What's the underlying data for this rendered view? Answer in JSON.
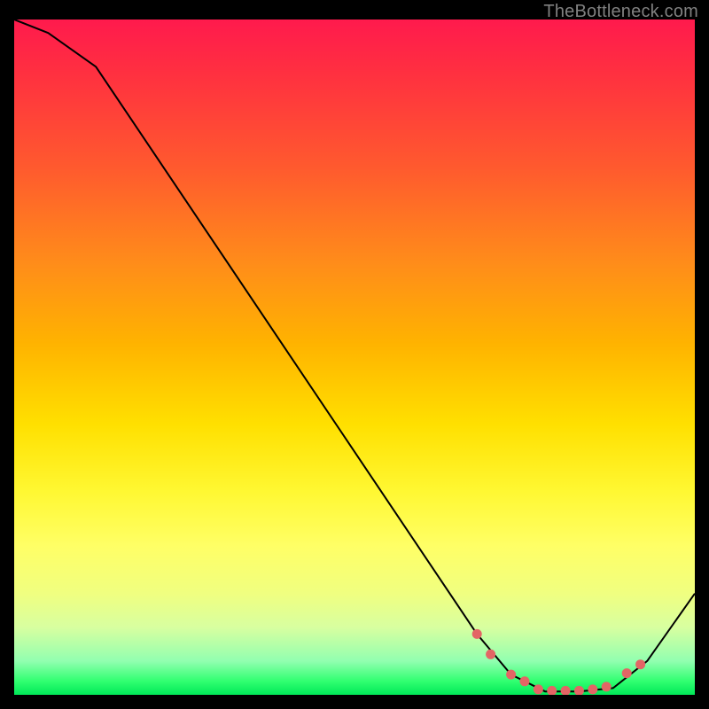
{
  "watermark": "TheBottleneck.com",
  "chart_data": {
    "type": "line",
    "title": "",
    "xlabel": "",
    "ylabel": "",
    "xlim": [
      0,
      100
    ],
    "ylim": [
      0,
      100
    ],
    "series": [
      {
        "name": "curve",
        "x": [
          0,
          5,
          12,
          68,
          73,
          78,
          83,
          88,
          93,
          100
        ],
        "values": [
          100,
          98,
          93,
          9,
          3,
          0.5,
          0.5,
          1,
          5,
          15
        ]
      }
    ],
    "markers": {
      "name": "dots",
      "color": "#e36565",
      "x": [
        68,
        70,
        73,
        75,
        77,
        79,
        81,
        83,
        85,
        87,
        90,
        92
      ],
      "values": [
        9,
        6,
        3,
        2,
        0.8,
        0.6,
        0.6,
        0.6,
        0.8,
        1.2,
        3.2,
        4.5
      ]
    },
    "colors": {
      "curve": "#000000",
      "marker": "#e36565",
      "background_top": "#ff1a4d",
      "background_bottom": "#00e858"
    }
  }
}
